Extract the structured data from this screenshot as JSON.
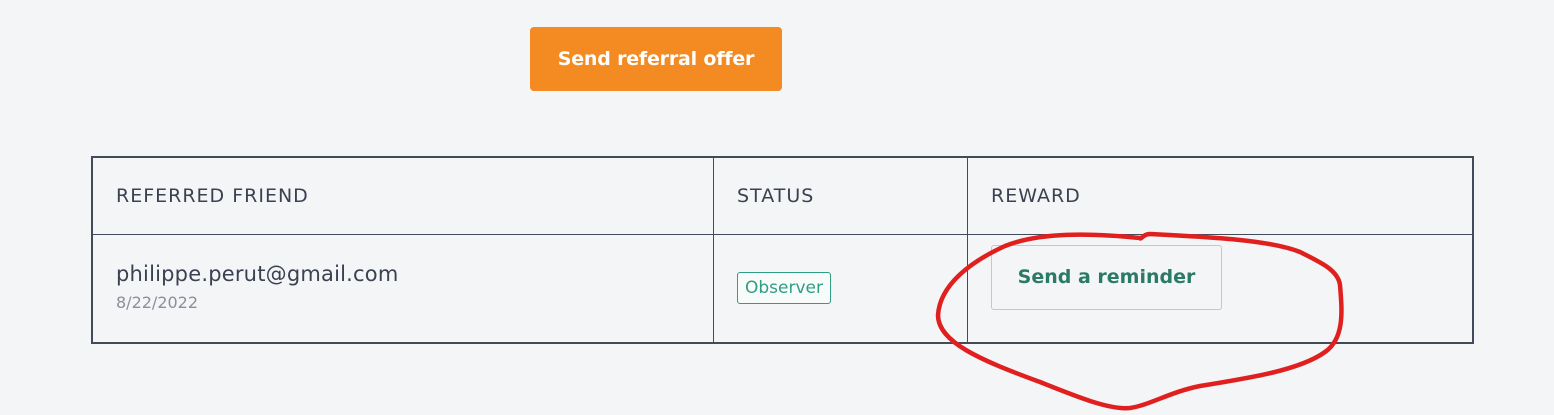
{
  "actions": {
    "send_referral_label": "Send referral offer"
  },
  "colors": {
    "primary": "#f48a22",
    "status_green": "#2f9e82",
    "annotation_red": "#e0201f"
  },
  "table": {
    "headers": [
      "REFERRED FRIEND",
      "STATUS",
      "REWARD"
    ],
    "rows": [
      {
        "email": "philippe.perut@gmail.com",
        "date": "8/22/2022",
        "status": "Observer",
        "reward_action": "Send a reminder"
      }
    ]
  }
}
